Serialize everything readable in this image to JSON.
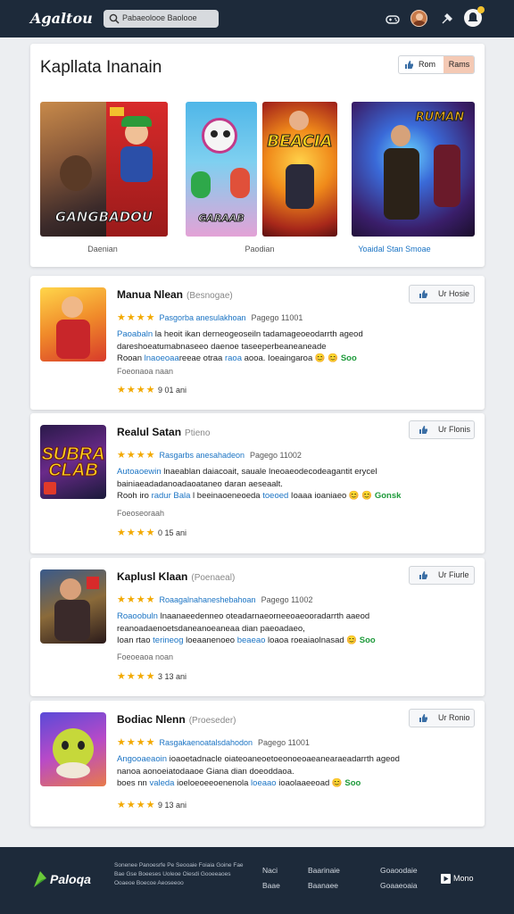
{
  "header": {
    "logo": "Agaltou",
    "search_text": "Pabaeolooe Baolooe"
  },
  "featured": {
    "title": "Kapllata Inanain",
    "seg_left": "Rom",
    "seg_right": "Rams",
    "tiles": [
      {
        "title": "GANGBADOU",
        "caption": ""
      },
      {
        "title": "GARAAB",
        "caption": ""
      },
      {
        "title": "BEACIA",
        "caption": ""
      },
      {
        "title": "RUMAN",
        "caption": ""
      }
    ],
    "captions": {
      "c1": "Daenian",
      "c2": "Paodian",
      "c3": "Yoaidal Stan Smoae"
    }
  },
  "games": [
    {
      "name": "Manua Nlean",
      "sub": "(Besnogae)",
      "stars": "★★★★",
      "meta": "Pasgorba anesulakhoan",
      "meta2": "Pagego 11001",
      "desc1_a": "Paoabaln",
      "desc1_b": " la heoit ikan derneogeoseiln tadamageoeodarrth ageod",
      "desc2": "dareshoeatumabnaseeo daenoe taseeperbeaneaneade",
      "desc3_a": "Rooan ",
      "desc3_b": "lnaoeoaa",
      "desc3_c": "reeae otraa ",
      "desc3_d": "raoa",
      "desc3_e": " aooa. Ioeaingaroa",
      "desc3_em": "😊 😊",
      "desc3_g": "Soo",
      "small": "Foeonaoa naan",
      "rating_stars": "★★★★",
      "rating": "9 01 ani",
      "like": "Ur Hosie"
    },
    {
      "name": "Realul Satan",
      "sub": "Ptieno",
      "stars": "★★★★",
      "meta": "Rasgarbs anesahadeon",
      "meta2": "Pagego 11002",
      "desc1_a": "Autoaoewin",
      "desc1_b": " lnaeablan daiacoait, sauale lneoaeodecodeagantit erycel",
      "desc2": "bainiaeadadanoadaoataneo daran aeseaalt.",
      "desc3_a": "Rooh iro ",
      "desc3_b": "radur Bala",
      "desc3_c": " l beeinaoeneoeda ",
      "desc3_d": "toeoed",
      "desc3_e": " Ioaaa ioaniaeo",
      "desc3_em": "😊 😊",
      "desc3_g": "Gonsk",
      "small": "Foeoseoraah",
      "rating_stars": "★★★★",
      "rating": "0 15 ani",
      "like": "Ur Flonis"
    },
    {
      "name": "Kaplusl Klaan",
      "sub": "(Poenaeal)",
      "stars": "★★★★",
      "meta": "Roaagalnahaneshebahoan",
      "meta2": "Pagego 11002",
      "desc1_a": "Roaoobuln",
      "desc1_b": " lnaanaeedenneo oteadarnaeorneeoaeooradarrth aaeod",
      "desc2": "reanoadaenoetsdaneanoeaneaa dian paeoadaeo,",
      "desc3_a": "Ioan rtao ",
      "desc3_b": "terineog",
      "desc3_c": " loeaanenoeo ",
      "desc3_d": "beaeao",
      "desc3_e": " loaoa roeaiaolnasad",
      "desc3_em": "😊",
      "desc3_g": "Soo",
      "small": "Foeoeaoa noan",
      "rating_stars": "★★★★",
      "rating": "3 13 ani",
      "like": "Ur Fiurle"
    },
    {
      "name": "Bodiac Nlenn",
      "sub": "(Proeseder)",
      "stars": "★★★★",
      "meta": "Rasgakaenoatalsdahodon",
      "meta2": "Pagego 11001",
      "desc1_a": "Angooaeaoin",
      "desc1_b": " ioaoetadnacle oiateoaneoetoeonoeoaeanearaeadarrth ageod",
      "desc2": "nanoa aonoeiatodaaoe Giana dian doeoddaoa.",
      "desc3_a": "boes nn ",
      "desc3_b": "valeda",
      "desc3_c": " ioeloeoeeoenenola ",
      "desc3_d": "loeaao",
      "desc3_e": " ioaolaaeeoad",
      "desc3_em": "😊",
      "desc3_g": "Soo",
      "small": "",
      "rating_stars": "★★★★",
      "rating": "9 13 ani",
      "like": "Ur Ronio"
    }
  ],
  "footer": {
    "logo": "Paloqa",
    "copy": "Sonenee Panoesrfe Pe Seooaie Foiaia Goine Fae Bae Gse Boeeses Uoleoe Oiesdi Gooeeaoes Ooaeoe Boecoe Aeoseeoo",
    "col1": [
      "Naci",
      "Baae"
    ],
    "col2": [
      "Baarinaie",
      "Baanaee"
    ],
    "col3": [
      "Goaoodaie",
      "Goaaeoaia"
    ],
    "button": "Mono"
  },
  "colors": {
    "header_bg": "#1d2a3a",
    "link": "#1b74c4",
    "star": "#f2a900",
    "accent_peach": "#f4c9b4"
  }
}
